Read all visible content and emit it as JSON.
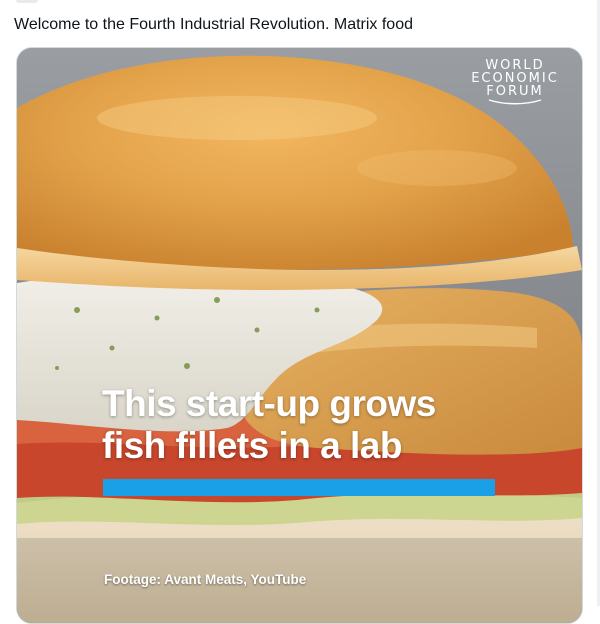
{
  "tweet": {
    "text": "Welcome to the Fourth Industrial Revolution. Matrix food"
  },
  "video": {
    "logo": {
      "line1": "WORLD",
      "line2": "ECONOMIC",
      "line3": "FORUM"
    },
    "headline": {
      "line1": "This start-up grows",
      "line2": "fish fillets in a lab"
    },
    "footage_credit": "Footage: Avant Meats, YouTube"
  },
  "colors": {
    "accent_bar": "#1aa0e6",
    "text": "#0f1419",
    "border": "#cfd9de"
  }
}
